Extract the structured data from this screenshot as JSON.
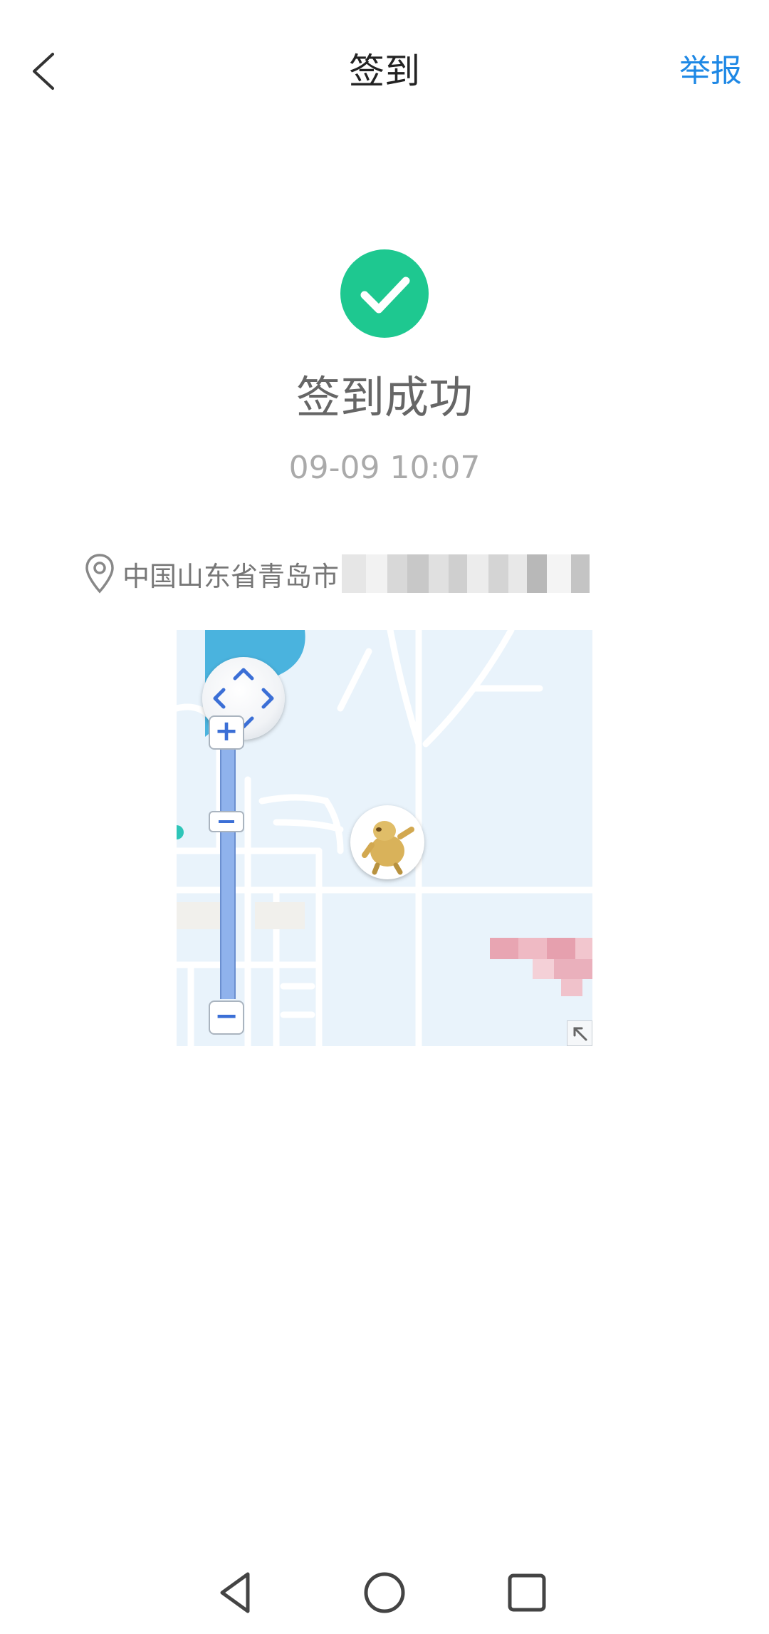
{
  "header": {
    "title": "签到",
    "report_label": "举报",
    "back_icon": "chevron-left-icon"
  },
  "status": {
    "icon": "check-circle-icon",
    "title": "签到成功",
    "time": "09-09 10:07"
  },
  "location": {
    "icon": "map-pin-icon",
    "text": "中国山东省青岛市"
  },
  "map": {
    "pan_icon": "pan-arrows-icon",
    "zoom_in_label": "+",
    "zoom_out_label": "−",
    "expand_icon": "expand-arrow-icon"
  },
  "navbar": {
    "back_icon": "triangle-back-icon",
    "home_icon": "circle-home-icon",
    "recents_icon": "square-recents-icon"
  },
  "colors": {
    "accent": "#1e88e5",
    "success": "#1ec890",
    "map_bg": "#e9f3fb"
  }
}
